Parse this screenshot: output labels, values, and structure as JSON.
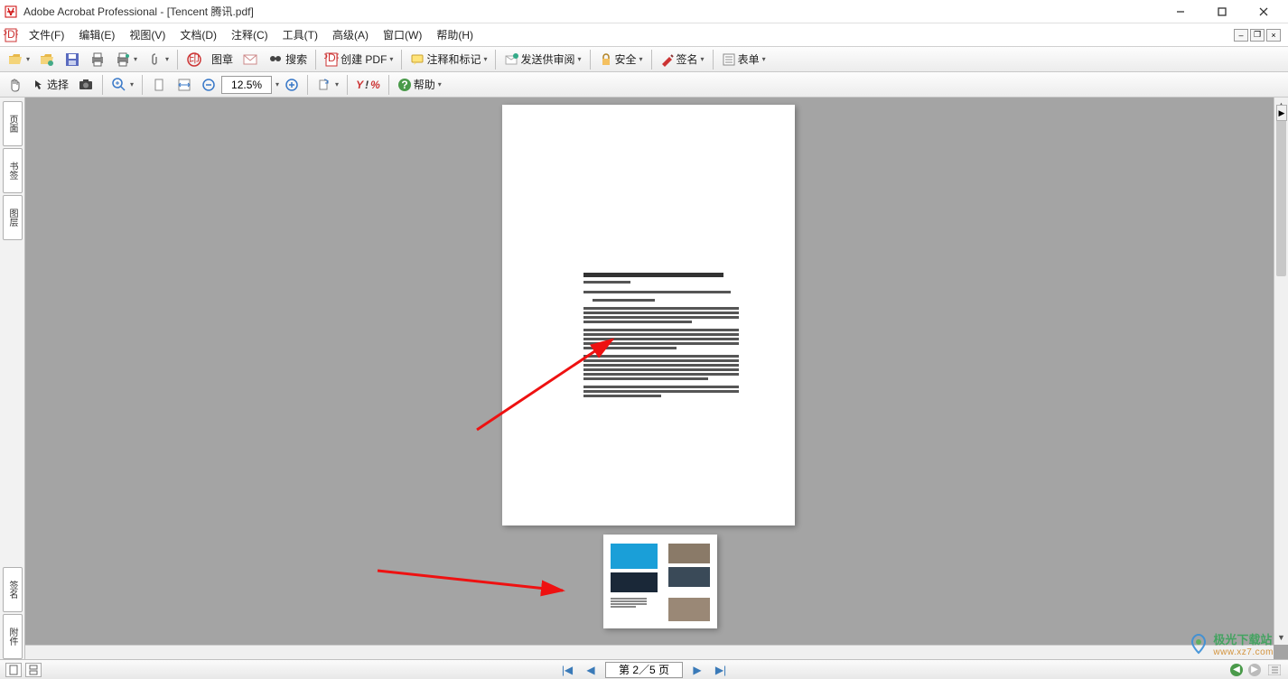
{
  "app": {
    "title": "Adobe Acrobat Professional - [Tencent 腾讯.pdf]"
  },
  "menu": {
    "file": "文件(F)",
    "edit": "编辑(E)",
    "view": "视图(V)",
    "document": "文档(D)",
    "comments": "注释(C)",
    "tools": "工具(T)",
    "advanced": "高级(A)",
    "window": "窗口(W)",
    "help": "帮助(H)"
  },
  "toolbar1": {
    "stamp": "图章",
    "search": "搜索",
    "create_pdf": "创建 PDF",
    "comment_markup": "注释和标记",
    "send_review": "发送供审阅",
    "secure": "安全",
    "sign": "签名",
    "forms": "表单"
  },
  "toolbar2": {
    "select": "选择",
    "zoom_value": "12.5%",
    "help": "帮助"
  },
  "sidebar": {
    "pages": "页面",
    "bookmarks": "书签",
    "layers": "图层",
    "signatures": "签名",
    "attachments": "附件"
  },
  "status": {
    "page_display": "第 2／5 页"
  },
  "watermark": {
    "name": "极光下载站",
    "url": "www.xz7.com"
  }
}
